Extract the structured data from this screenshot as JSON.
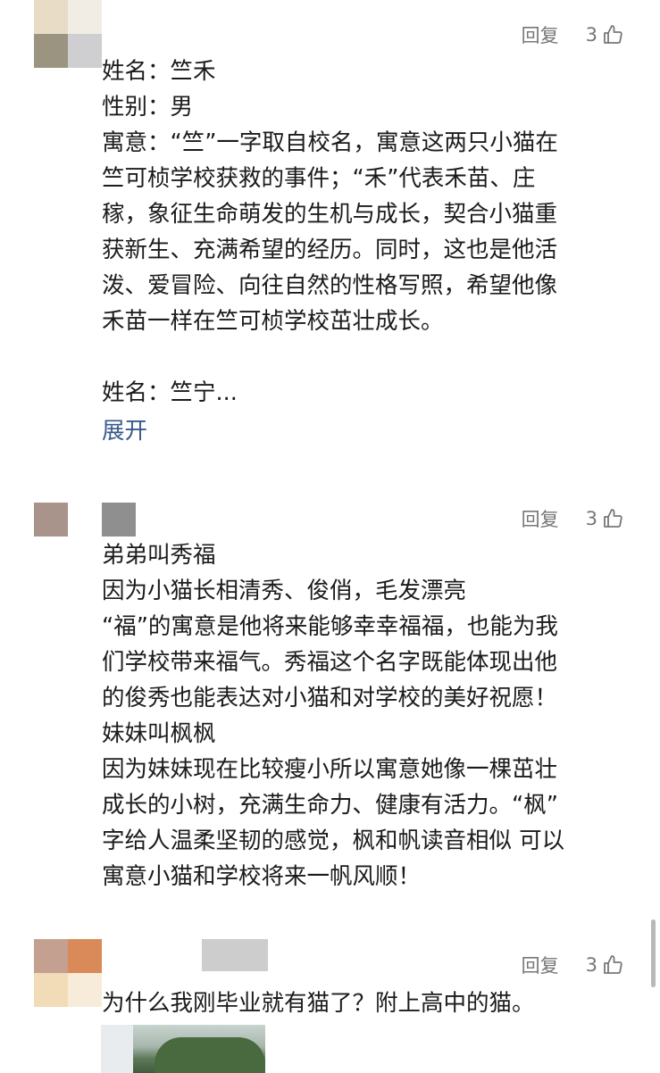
{
  "comments": [
    {
      "reply_label": "回复",
      "like_count": "3",
      "lines": [
        "姓名：竺禾",
        "性别：男",
        "寓意：“竺”一字取自校名，寓意这两只小猫在",
        "竺可桢学校获救的事件；“禾”代表禾苗、庄",
        "稼，象征生命萌发的生机与成长，契合小猫重",
        "获新生、充满希望的经历。同时，这也是他活",
        "泼、爱冒险、向往自然的性格写照，希望他像",
        "禾苗一样在竺可桢学校茁壮成长。",
        "",
        "姓名：竺宁..."
      ],
      "expand_label": "展开"
    },
    {
      "reply_label": "回复",
      "like_count": "3",
      "lines": [
        "弟弟叫秀福",
        "因为小猫长相清秀、俊俏，毛发漂亮",
        "“福”的寓意是他将来能够幸幸福福，也能为我",
        "们学校带来福气。秀福这个名字既能体现出他",
        "的俊秀也能表达对小猫和对学校的美好祝愿！",
        "妹妹叫枫枫",
        "因为妹妹现在比较瘦小所以寓意她像一棵茁壮",
        "成长的小树，充满生命力、健康有活力。“枫”",
        "字给人温柔坚韧的感觉，枫和帆读音相似 可以",
        "寓意小猫和学校将来一帆风顺！"
      ]
    },
    {
      "reply_label": "回复",
      "like_count": "3",
      "lines": [
        "为什么我刚毕业就有猫了？附上高中的猫。"
      ]
    }
  ],
  "icons": {
    "like": "thumbs-up-icon"
  },
  "colors": {
    "link": "#3a5a8c",
    "meta": "#777777"
  }
}
